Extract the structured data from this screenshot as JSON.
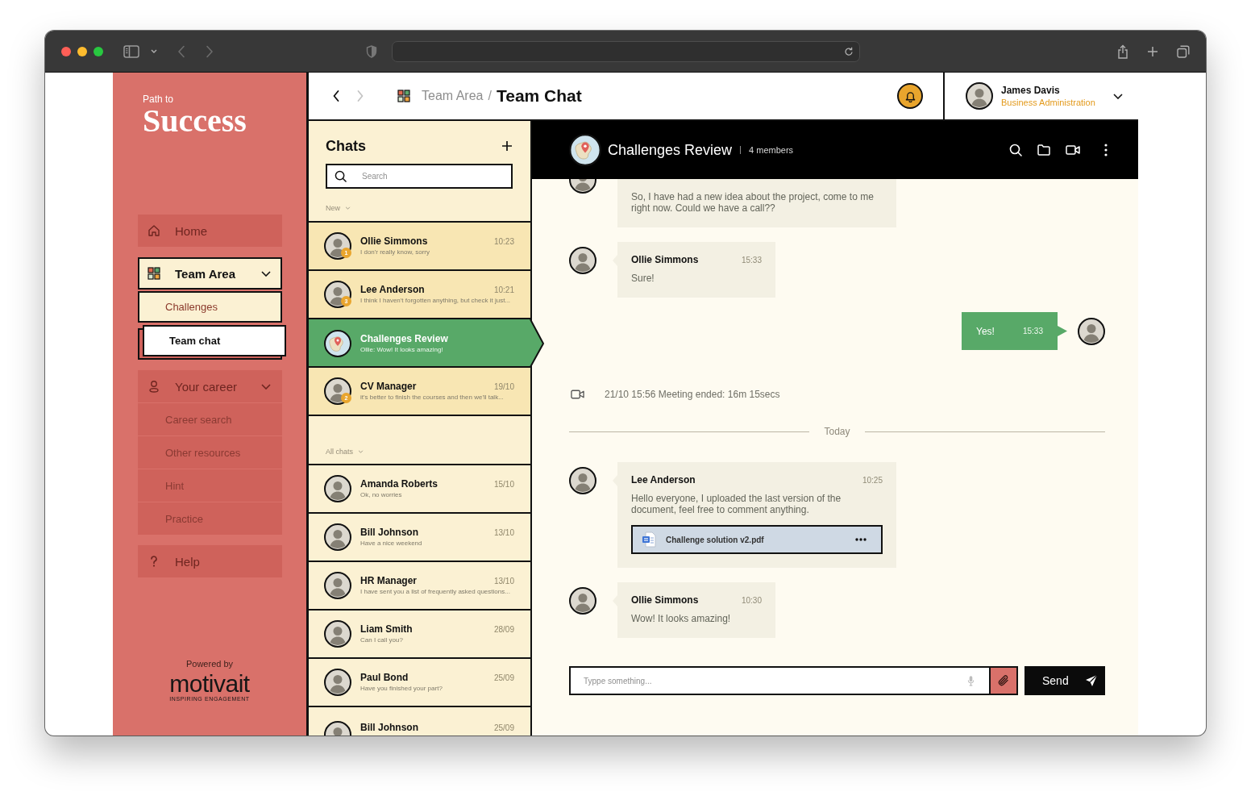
{
  "sidebar": {
    "tagline": "Path to",
    "brand": "Success",
    "nav": [
      {
        "kind": "link",
        "label": "Home",
        "selected": false
      },
      {
        "kind": "group",
        "label": "Team Area",
        "selected": true,
        "expanded": true,
        "children": [
          {
            "label": "Challenges",
            "selected": false
          },
          {
            "label": "Team chat",
            "selected": true
          }
        ]
      },
      {
        "kind": "group",
        "label": "Your career",
        "selected": false,
        "expanded": true,
        "children": [
          {
            "label": "Career search",
            "selected": false
          },
          {
            "label": "Other resources",
            "selected": false
          },
          {
            "label": "Hint",
            "selected": false
          },
          {
            "label": "Practice",
            "selected": false
          }
        ]
      },
      {
        "kind": "link",
        "label": "Help",
        "selected": false
      }
    ],
    "powered_by": "Powered by",
    "logo": "motivait",
    "logo_tagline": "INSPIRING ENGAGEMENT"
  },
  "header": {
    "back": {
      "disabled": false
    },
    "forward": {
      "disabled": true
    },
    "breadcrumb": {
      "parent": "Team Area",
      "separator": "/",
      "current": "Team Chat"
    },
    "user": {
      "name": "James Davis",
      "role": "Business Administration"
    }
  },
  "chats": {
    "title": "Chats",
    "search": {
      "placeholder": "Search"
    },
    "sections": [
      {
        "label": "New",
        "kind": "new",
        "items": [
          {
            "kind": "person",
            "name": "Ollie Simmons",
            "preview": "I don'r really know, sorry",
            "time": "10:23",
            "unread": "1",
            "selected": false
          },
          {
            "kind": "person",
            "name": "Lee Anderson",
            "preview": "I think I haven't forgotten anything, but check it just...",
            "time": "10:21",
            "unread": "3",
            "selected": false
          },
          {
            "kind": "group",
            "name": "Challenges Review",
            "preview": "Ollie: Wow! It looks amazing!",
            "selected": true
          },
          {
            "kind": "person",
            "name": "CV Manager",
            "preview": "it's better to finish the courses and then we'll talk...",
            "time": "19/10",
            "unread": "2",
            "selected": false
          }
        ]
      },
      {
        "label": "All chats",
        "kind": "all",
        "items": [
          {
            "kind": "person",
            "name": "Amanda Roberts",
            "preview": "Ok, no worries",
            "time": "15/10",
            "selected": false
          },
          {
            "kind": "person",
            "name": "Bill Johnson",
            "preview": "Have a nice weekend",
            "time": "13/10",
            "selected": false
          },
          {
            "kind": "person",
            "name": "HR Manager",
            "preview": "I have sent you a list of frequently asked questions...",
            "time": "13/10",
            "selected": false
          },
          {
            "kind": "person",
            "name": "Liam Smith",
            "preview": "Can I call you?",
            "time": "28/09",
            "selected": false
          },
          {
            "kind": "person",
            "name": "Paul Bond",
            "preview": "Have you finished your part?",
            "time": "25/09",
            "selected": false
          },
          {
            "kind": "person",
            "name": "Bill Johnson",
            "time": "25/09",
            "selected": false
          }
        ]
      }
    ]
  },
  "conversation": {
    "title": "Challenges Review",
    "members": "4 members",
    "messages": [
      {
        "kind": "incoming",
        "text": "So, I have had a new idea about the project, come to me right now. Could we have a call??"
      },
      {
        "kind": "incoming",
        "author": "Ollie Simmons",
        "time": "15:33",
        "text": "Sure!"
      },
      {
        "kind": "outgoing",
        "time": "15:33",
        "text": "Yes!"
      },
      {
        "kind": "event",
        "text": "21/10 15:56 Meeting ended: 16m 15secs"
      },
      {
        "kind": "divider",
        "text": "Today"
      },
      {
        "kind": "incoming",
        "author": "Lee Anderson",
        "time": "10:25",
        "text": "Hello everyone, I uploaded the last version of the document, feel free to comment anything.",
        "attachment": {
          "name": "Challenge solution v2.pdf"
        }
      },
      {
        "kind": "incoming",
        "author": "Ollie Simmons",
        "time": "10:30",
        "text": "Wow! It looks amazing!"
      }
    ],
    "composer": {
      "placeholder": "Typpe something...",
      "send": "Send"
    }
  }
}
